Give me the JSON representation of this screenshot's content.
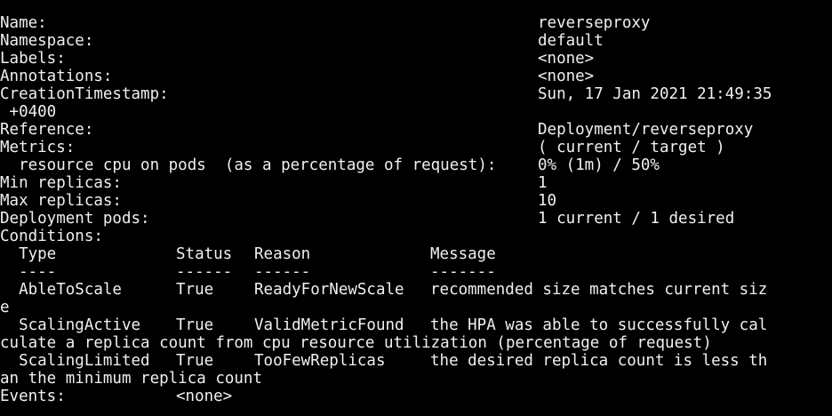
{
  "terminal": {
    "fields": {
      "name_label": "Name:",
      "name_value": "reverseproxy",
      "namespace_label": "Namespace:",
      "namespace_value": "default",
      "labels_label": "Labels:",
      "labels_value": "<none>",
      "annotations_label": "Annotations:",
      "annotations_value": "<none>",
      "creation_label": "CreationTimestamp:",
      "creation_value": "Sun, 17 Jan 2021 21:49:35",
      "creation_wrap": " +0400",
      "reference_label": "Reference:",
      "reference_value": "Deployment/reverseproxy",
      "metrics_label": "Metrics:",
      "metrics_value": "( current / target )",
      "metric_resource_label": "  resource cpu on pods  (as a percentage of request):",
      "metric_resource_value": "0% (1m) / 50%",
      "min_replicas_label": "Min replicas:",
      "min_replicas_value": "1",
      "max_replicas_label": "Max replicas:",
      "max_replicas_value": "10",
      "deployment_pods_label": "Deployment pods:",
      "deployment_pods_value": "1 current / 1 desired",
      "conditions_label": "Conditions:"
    },
    "conditions": {
      "headers": {
        "type": "  Type",
        "status": "Status",
        "reason": "Reason",
        "message": "Message"
      },
      "underlines": {
        "type": "  ----",
        "status": "------",
        "reason": "------",
        "message": "-------"
      },
      "rows": [
        {
          "type": "  AbleToScale",
          "status": "True",
          "reason": "ReadyForNewScale",
          "message": "recommended size matches current siz",
          "wrap": "e"
        },
        {
          "type": "  ScalingActive",
          "status": "True",
          "reason": "ValidMetricFound",
          "message": "the HPA was able to successfully cal",
          "wrap": "culate a replica count from cpu resource utilization (percentage of request)"
        },
        {
          "type": "  ScalingLimited",
          "status": "True",
          "reason": "TooFewReplicas",
          "message": "the desired replica count is less th",
          "wrap": "an the minimum replica count"
        }
      ]
    },
    "events": {
      "label": "Events:",
      "value": "<none>"
    }
  }
}
